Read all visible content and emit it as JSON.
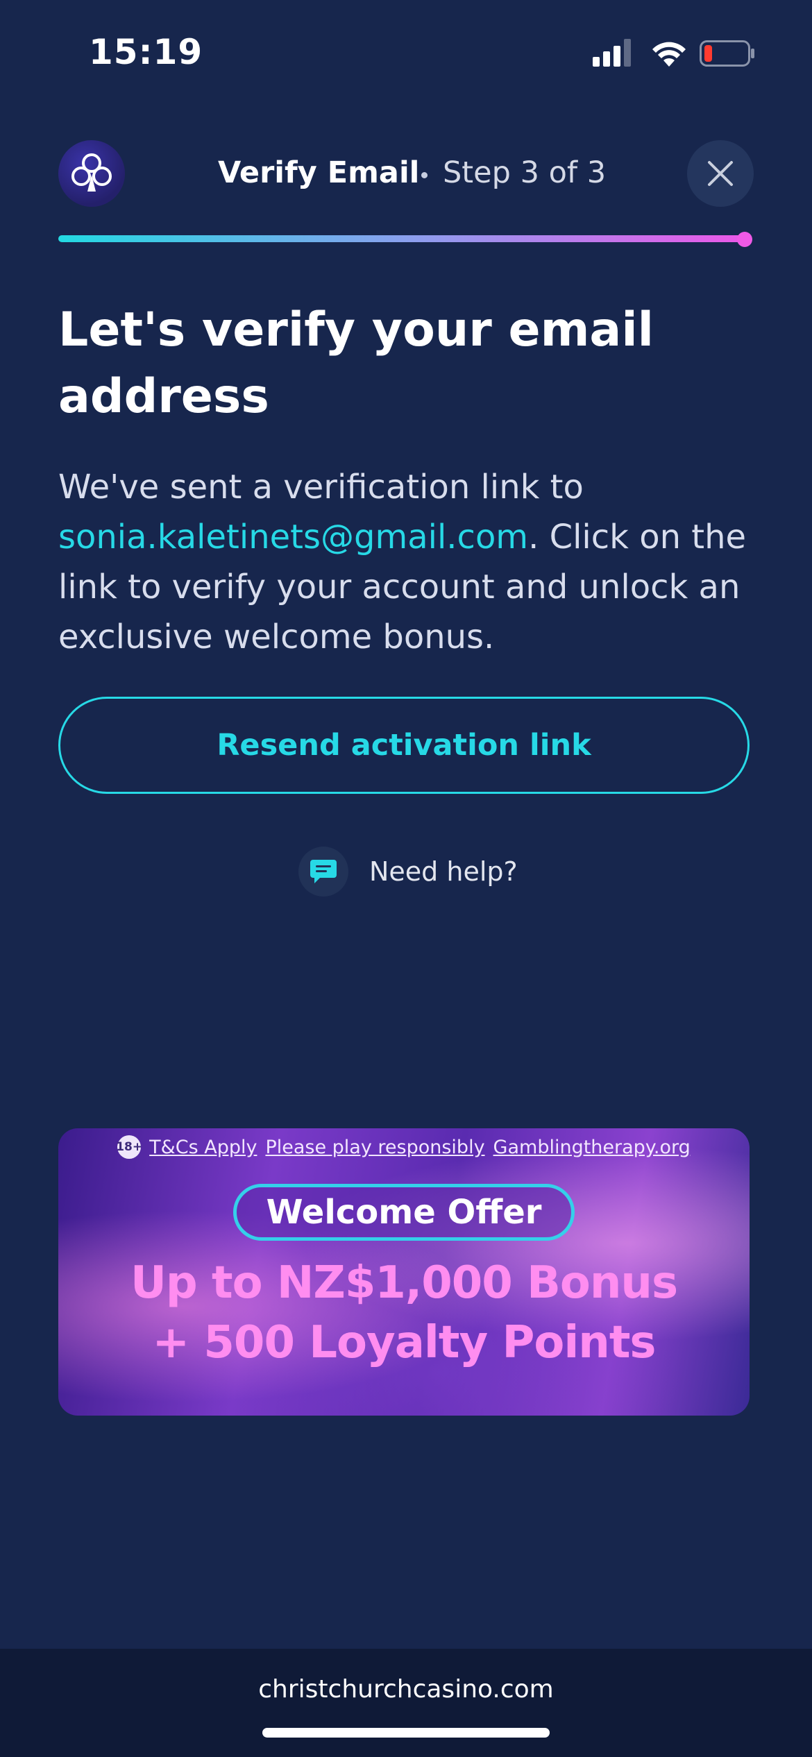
{
  "status": {
    "time": "15:19"
  },
  "header": {
    "title": "Verify Email",
    "step": "Step 3 of 3",
    "close_icon": "close-icon",
    "logo_icon": "club-icon"
  },
  "progress": {
    "value": 1.0,
    "gradient": [
      "#23d9e2",
      "#ec57e8"
    ]
  },
  "main": {
    "heading": "Let's verify your email address",
    "body_prefix": "We've sent a verification link to",
    "email": "sonia.kaletinets@gmail.com",
    "body_suffix": ". Click on the link to verify your account and unlock an exclusive welcome bonus.",
    "resend_label": "Resend activation link",
    "help_label": "Need help?",
    "help_icon": "chat-icon"
  },
  "banner": {
    "age": "18+",
    "links": [
      "T&Cs Apply",
      "Please play responsibly",
      "Gamblingtherapy.org"
    ],
    "pill": "Welcome Offer",
    "line1": "Up to NZ$1,000 Bonus",
    "line2": "+ 500 Loyalty Points"
  },
  "footer": {
    "url": "christchurchcasino.com"
  },
  "colors": {
    "accent": "#27d9e6",
    "offer": "#ff8df0",
    "background": "#17264d"
  }
}
